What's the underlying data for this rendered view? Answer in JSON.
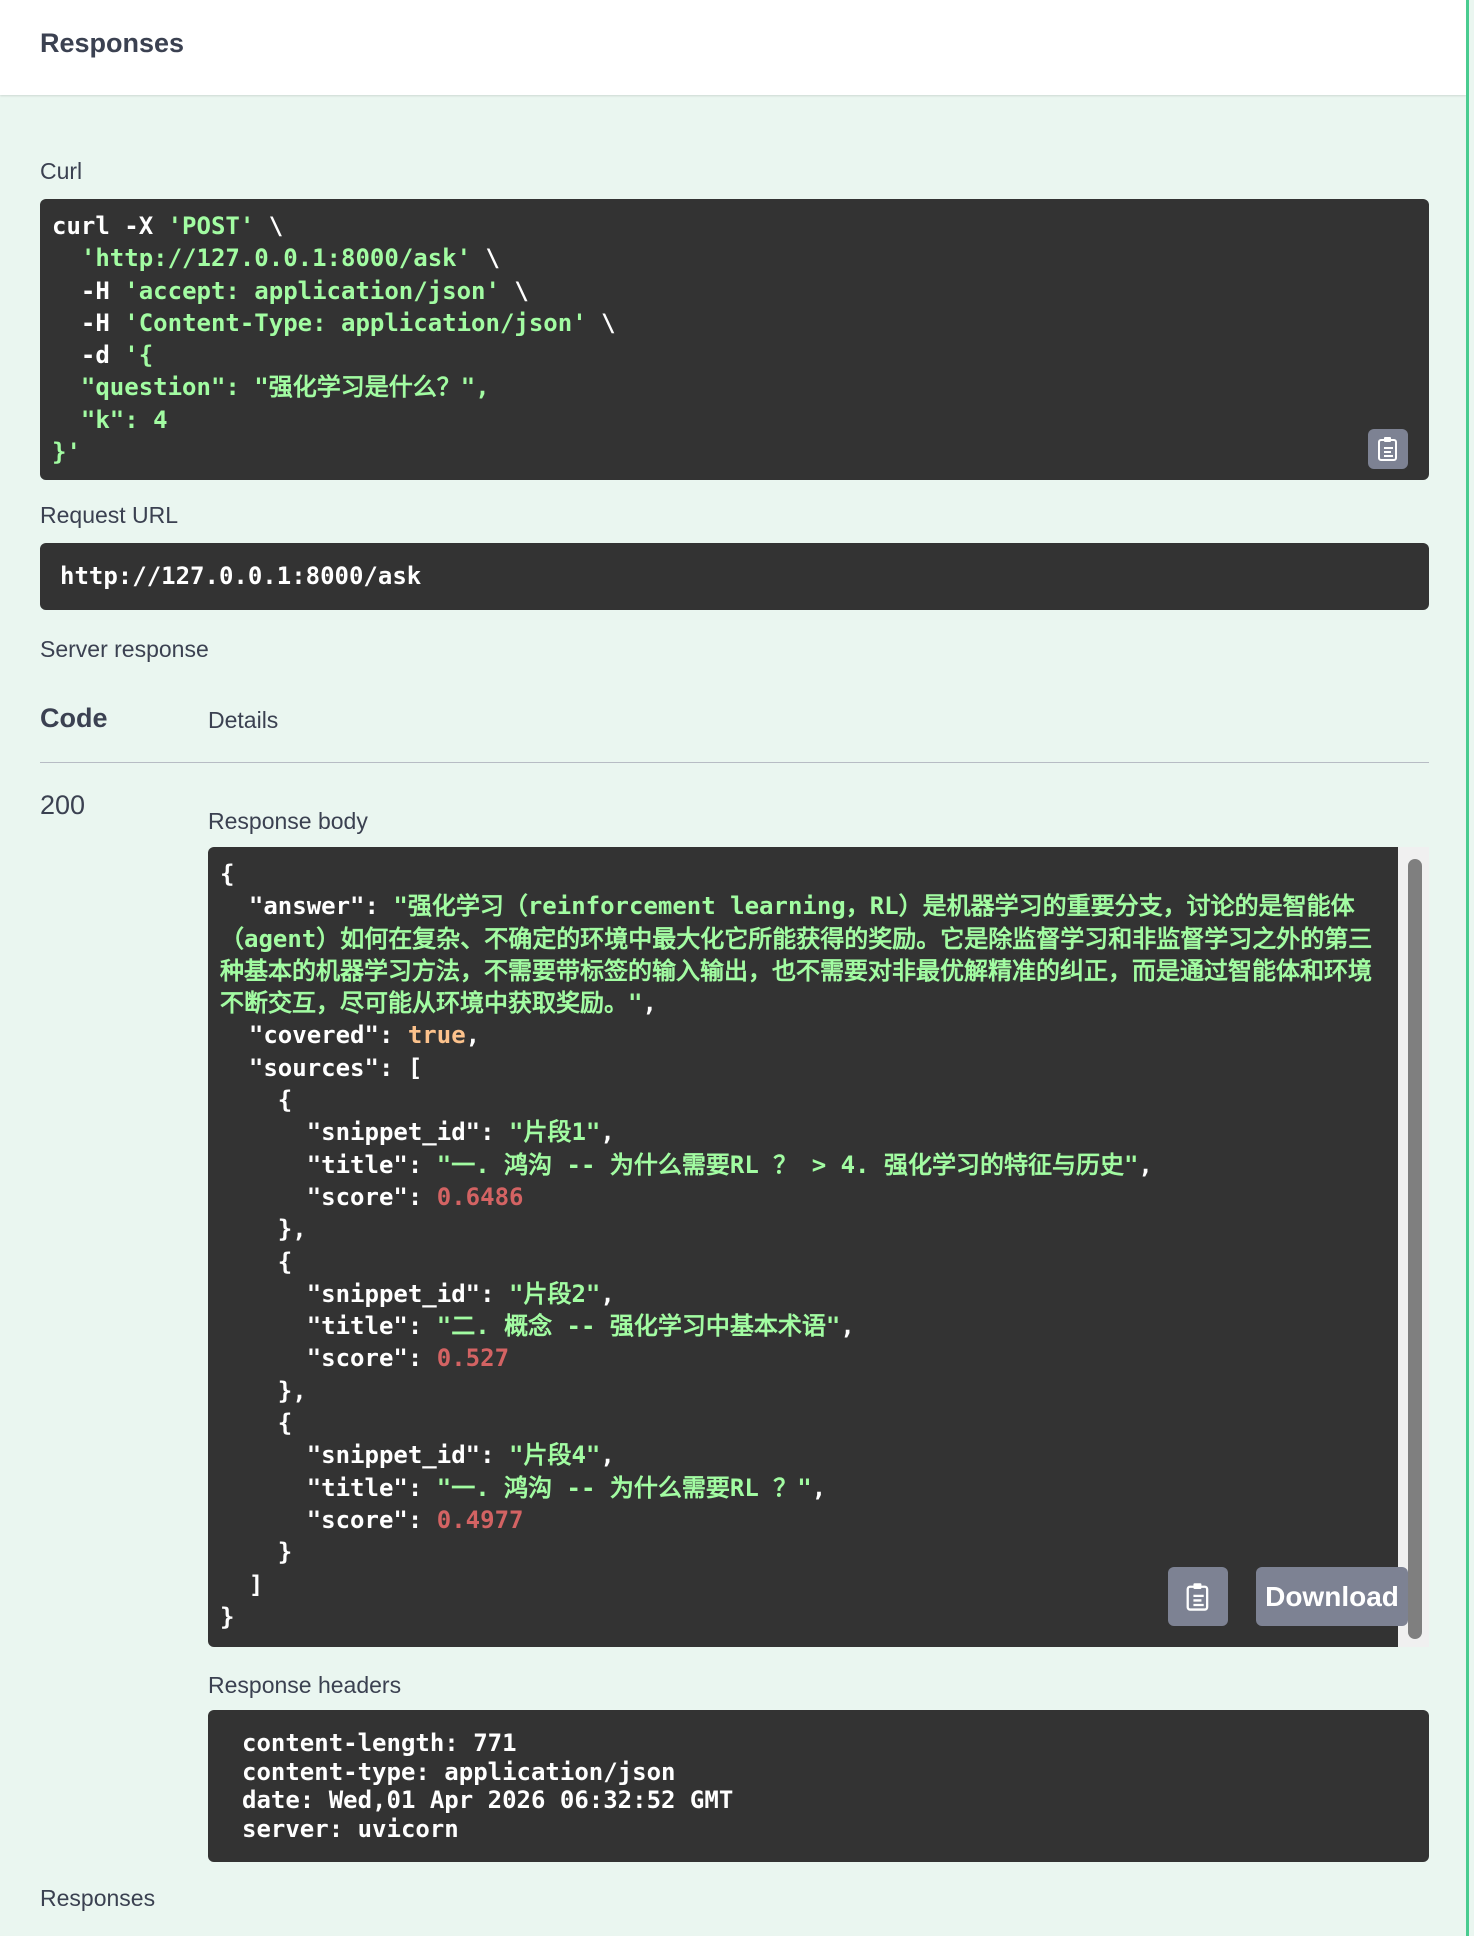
{
  "header": {
    "title": "Responses"
  },
  "curl_section": {
    "label": "Curl",
    "lines": {
      "l1_pre": "curl -X ",
      "l1_str": "'POST'",
      "l1_post": " \\",
      "l2_str": "'http://127.0.0.1:8000/ask'",
      "l2_post": " \\",
      "l3_pre": "-H ",
      "l3_str": "'accept: application/json'",
      "l3_post": " \\",
      "l4_pre": "-H ",
      "l4_str": "'Content-Type: application/json'",
      "l4_post": " \\",
      "l5_pre": "-d ",
      "l5_str": "'{",
      "l6": "\"question\": \"强化学习是什么？\",",
      "l7": "\"k\": 4",
      "l8": "}'"
    }
  },
  "request_url": {
    "label": "Request URL",
    "value": "http://127.0.0.1:8000/ask"
  },
  "server_response": {
    "label": "Server response",
    "col_code": "Code",
    "col_details": "Details",
    "status_code": "200",
    "response_body_label": "Response body",
    "download_label": "Download",
    "response_headers_label": "Response headers"
  },
  "response_body": {
    "open_brace": "{",
    "answer_key": "\"answer\"",
    "answer_value": "\"强化学习（reinforcement learning，RL）是机器学习的重要分支，讨论的是智能体（agent）如何在复杂、不确定的环境中最大化它所能获得的奖励。它是除监督学习和非监督学习之外的第三种基本的机器学习方法，不需要带标签的输入输出，也不需要对非最优解精准的纠正，而是通过智能体和环境不断交互，尽可能从环境中获取奖励。\"",
    "covered_key": "\"covered\"",
    "covered_value": "true",
    "sources_key": "\"sources\"",
    "sources": [
      {
        "snippet_id": "\"片段1\"",
        "title": "\"一. 鸿沟 -- 为什么需要RL ？ > 4. 强化学习的特征与历史\"",
        "score": "0.6486"
      },
      {
        "snippet_id": "\"片段2\"",
        "title": "\"二. 概念 -- 强化学习中基本术语\"",
        "score": "0.527"
      },
      {
        "snippet_id": "\"片段4\"",
        "title": "\"一. 鸿沟 -- 为什么需要RL ？\"",
        "score": "0.4977"
      }
    ],
    "k_snippet": "\"snippet_id\"",
    "k_title": "\"title\"",
    "k_score": "\"score\""
  },
  "response_headers": {
    "lines": [
      "content-length: 771",
      "content-type: application/json",
      "date: Wed,01 Apr 2026 06:32:52 GMT",
      "server: uvicorn"
    ]
  },
  "footer": {
    "label": "Responses"
  },
  "colors": {
    "background": "#eaf6f0",
    "code_bg": "#333333",
    "string": "#a2fca2",
    "keyword": "#fcc28c",
    "number": "#d36363",
    "accent": "#49cc90"
  },
  "icons": {
    "copy": "clipboard-copy-icon"
  }
}
